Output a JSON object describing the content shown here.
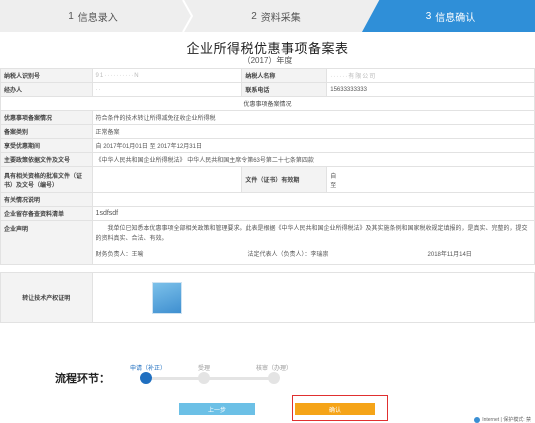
{
  "steps": [
    {
      "num": "1",
      "label": "信息录入"
    },
    {
      "num": "2",
      "label": "资料采集"
    },
    {
      "num": "3",
      "label": "信息确认"
    }
  ],
  "title": "企业所得税优惠事项备案表",
  "year_line": "（2017）年度",
  "rows": {
    "taxpayer_id_label": "纳税人识别号",
    "taxpayer_id_value": "91··········N",
    "taxpayer_name_label": "纳税人名称",
    "taxpayer_name_value": "······有限公司",
    "agent_label": "经办人",
    "agent_value": "··",
    "phone_label": "联系电话",
    "phone_value": "15633333333",
    "section_header": "优惠事项备案情况",
    "preferential_label": "优惠事项备案情况",
    "preferential_value": "符合条件的技术转让所得减免征收企业所得税",
    "record_type_label": "备案类别",
    "record_type_value": "正常备案",
    "period_label": "享受优惠期间",
    "period_value": "自 2017年01月01日 至 2017年12月31日",
    "policy_label": "主要政策依据文件及文号",
    "policy_value": "《中华人民共和国企业所得税法》 中华人民共和国主席令第63号第二十七条第四款",
    "qualification_label": "具有相关资格的批准文件（证书）及文号（编号）",
    "qualification_value": "",
    "cert_valid_label": "文件（证书）有效期",
    "cert_from": "自",
    "cert_to": "至",
    "remarks_label": "有关情况说明",
    "remarks_value": "",
    "materials_label": "企业留存备查资料清单",
    "materials_value": "1sdfsdf",
    "declaration_label": "企业声明",
    "declaration_text": "我单位已知悉本优惠事项全部相关政策和管理要求。此表是根据《中华人民共和国企业所得税法》及其实施条例和国家税收规定填报的，是真实、完整的，提交的资料真实、合法、有效。",
    "finance_head": "财务负责人：王喻",
    "legal_rep": "法定代表人（负责人）：李瑞崇",
    "sign_date": "2018年11月14日",
    "attachment_label": "转让技术产权证明"
  },
  "flow": {
    "label": "流程环节：",
    "steps": [
      "申请（补正）",
      "受理",
      "核审（办理）"
    ]
  },
  "buttons": {
    "prev": "上一步",
    "confirm": "确认"
  },
  "status_bar": "Internet | 保护模式: 禁"
}
